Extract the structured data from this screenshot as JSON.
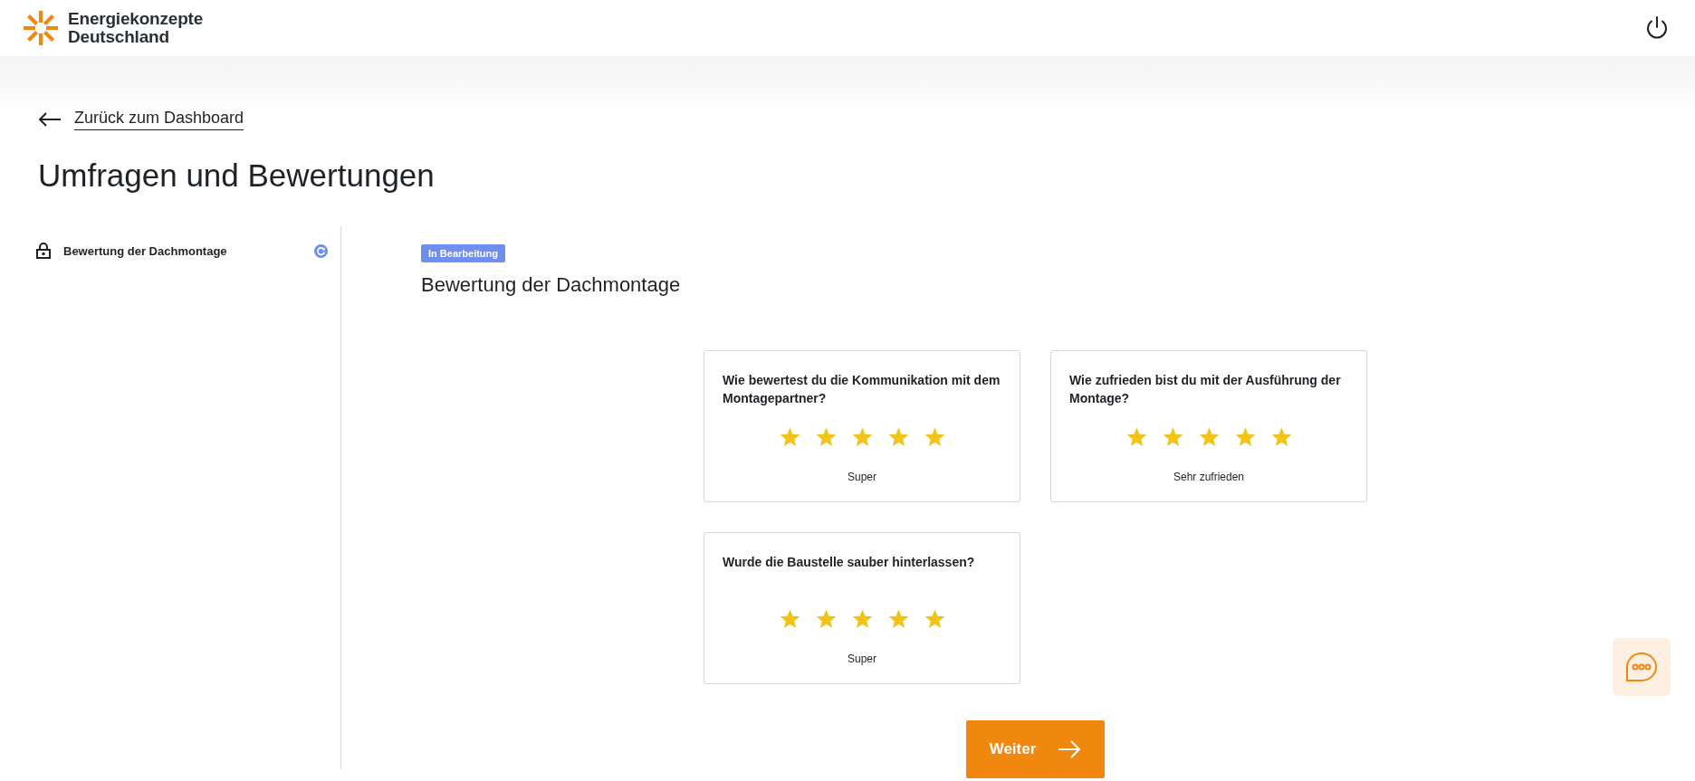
{
  "header": {
    "brand_line_1": "Energiekonzepte",
    "brand_line_2": "Deutschland"
  },
  "back_link": "Zurück zum Dashboard",
  "page_title": "Umfragen und Bewertungen",
  "sidebar": {
    "items": [
      {
        "label": "Bewertung der Dachmontage"
      }
    ]
  },
  "survey": {
    "badge": "In Bearbeitung",
    "title": "Bewertung der Dachmontage",
    "questions": [
      {
        "question": "Wie bewertest du die Kommunikation mit dem Montagepartner?",
        "stars": 5,
        "answer": "Super"
      },
      {
        "question": "Wie zufrieden bist du mit der Ausführung der Montage?",
        "stars": 5,
        "answer": "Sehr zufrieden"
      },
      {
        "question": "Wurde die Baustelle sauber hinterlassen?",
        "stars": 5,
        "answer": "Super"
      }
    ],
    "next_button": "Weiter"
  }
}
